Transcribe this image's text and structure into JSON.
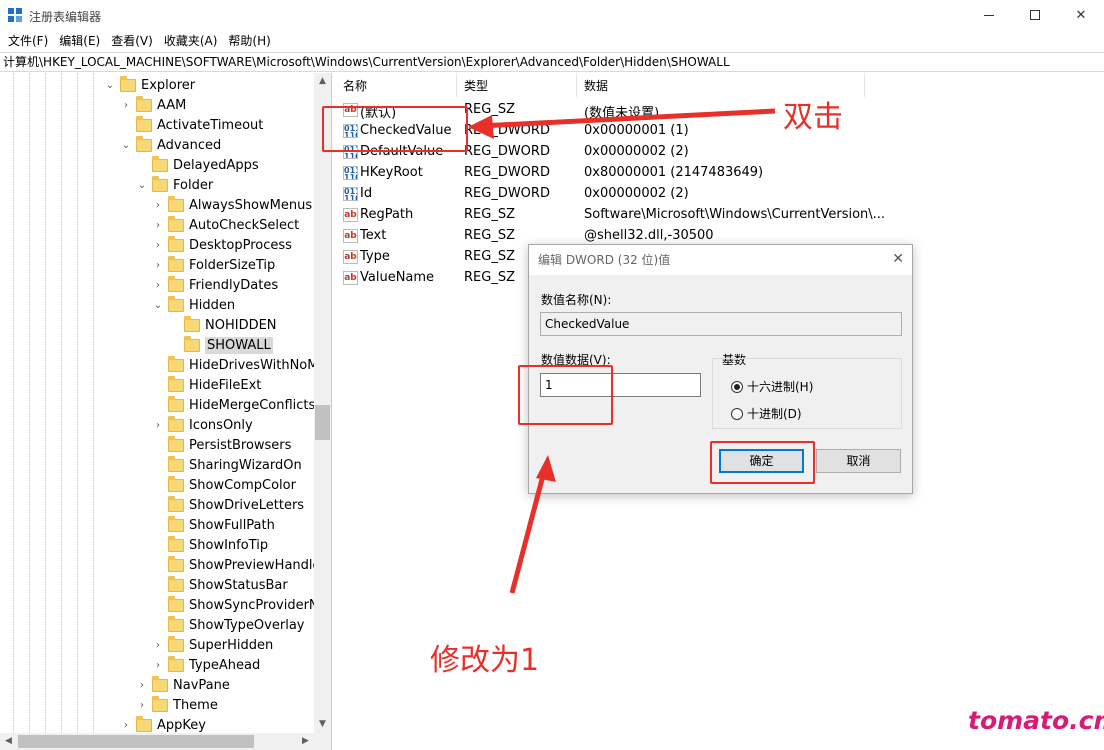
{
  "window": {
    "title": "注册表编辑器"
  },
  "menu": [
    "文件(F)",
    "编辑(E)",
    "查看(V)",
    "收藏夹(A)",
    "帮助(H)"
  ],
  "address": "计算机\\HKEY_LOCAL_MACHINE\\SOFTWARE\\Microsoft\\Windows\\CurrentVersion\\Explorer\\Advanced\\Folder\\Hidden\\SHOWALL",
  "tree": [
    {
      "label": "Explorer",
      "expanded": true
    },
    {
      "label": "AAM",
      "expanded": false
    },
    {
      "label": "ActivateTimeout"
    },
    {
      "label": "Advanced",
      "expanded": true
    },
    {
      "label": "DelayedApps"
    },
    {
      "label": "Folder",
      "expanded": true
    },
    {
      "label": "AlwaysShowMenus",
      "expanded": false
    },
    {
      "label": "AutoCheckSelect",
      "expanded": false
    },
    {
      "label": "DesktopProcess",
      "expanded": false
    },
    {
      "label": "FolderSizeTip",
      "expanded": false
    },
    {
      "label": "FriendlyDates",
      "expanded": false
    },
    {
      "label": "Hidden",
      "expanded": true
    },
    {
      "label": "NOHIDDEN"
    },
    {
      "label": "SHOWALL",
      "selected": true
    },
    {
      "label": "HideDrivesWithNoMe"
    },
    {
      "label": "HideFileExt"
    },
    {
      "label": "HideMergeConflicts"
    },
    {
      "label": "IconsOnly",
      "expanded": false
    },
    {
      "label": "PersistBrowsers"
    },
    {
      "label": "SharingWizardOn"
    },
    {
      "label": "ShowCompColor"
    },
    {
      "label": "ShowDriveLetters"
    },
    {
      "label": "ShowFullPath"
    },
    {
      "label": "ShowInfoTip"
    },
    {
      "label": "ShowPreviewHandlers"
    },
    {
      "label": "ShowStatusBar"
    },
    {
      "label": "ShowSyncProviderNot"
    },
    {
      "label": "ShowTypeOverlay"
    },
    {
      "label": "SuperHidden",
      "expanded": false
    },
    {
      "label": "TypeAhead",
      "expanded": false
    },
    {
      "label": "NavPane",
      "expanded": false
    },
    {
      "label": "Theme",
      "expanded": false
    },
    {
      "label": "AppKey",
      "expanded": false
    }
  ],
  "list": {
    "columns": [
      "名称",
      "类型",
      "数据"
    ],
    "rows": [
      {
        "icon": "string-value-icon",
        "name": "(默认)",
        "type": "REG_SZ",
        "data": "(数值未设置)"
      },
      {
        "icon": "dword-value-icon",
        "name": "CheckedValue",
        "type": "REG_DWORD",
        "data": "0x00000001 (1)"
      },
      {
        "icon": "dword-value-icon",
        "name": "DefaultValue",
        "type": "REG_DWORD",
        "data": "0x00000002 (2)"
      },
      {
        "icon": "dword-value-icon",
        "name": "HKeyRoot",
        "type": "REG_DWORD",
        "data": "0x80000001 (2147483649)"
      },
      {
        "icon": "dword-value-icon",
        "name": "Id",
        "type": "REG_DWORD",
        "data": "0x00000002 (2)"
      },
      {
        "icon": "string-value-icon",
        "name": "RegPath",
        "type": "REG_SZ",
        "data": "Software\\Microsoft\\Windows\\CurrentVersion\\..."
      },
      {
        "icon": "string-value-icon",
        "name": "Text",
        "type": "REG_SZ",
        "data": "@shell32.dll,-30500"
      },
      {
        "icon": "string-value-icon",
        "name": "Type",
        "type": "REG_SZ",
        "data": ""
      },
      {
        "icon": "string-value-icon",
        "name": "ValueName",
        "type": "REG_SZ",
        "data": ""
      }
    ]
  },
  "dialog": {
    "title": "编辑 DWORD (32 位)值",
    "name_label": "数值名称(N):",
    "name_value": "CheckedValue",
    "data_label": "数值数据(V):",
    "data_value": "1",
    "base_label": "基数",
    "radio_hex": "十六进制(H)",
    "radio_dec": "十进制(D)",
    "base_selected": "hex",
    "ok": "确定",
    "cancel": "取消"
  },
  "annotations": {
    "double_click": "双击",
    "change_to": "修改为1",
    "accent_color": "#e8302a"
  },
  "watermark": "tomato.cm"
}
